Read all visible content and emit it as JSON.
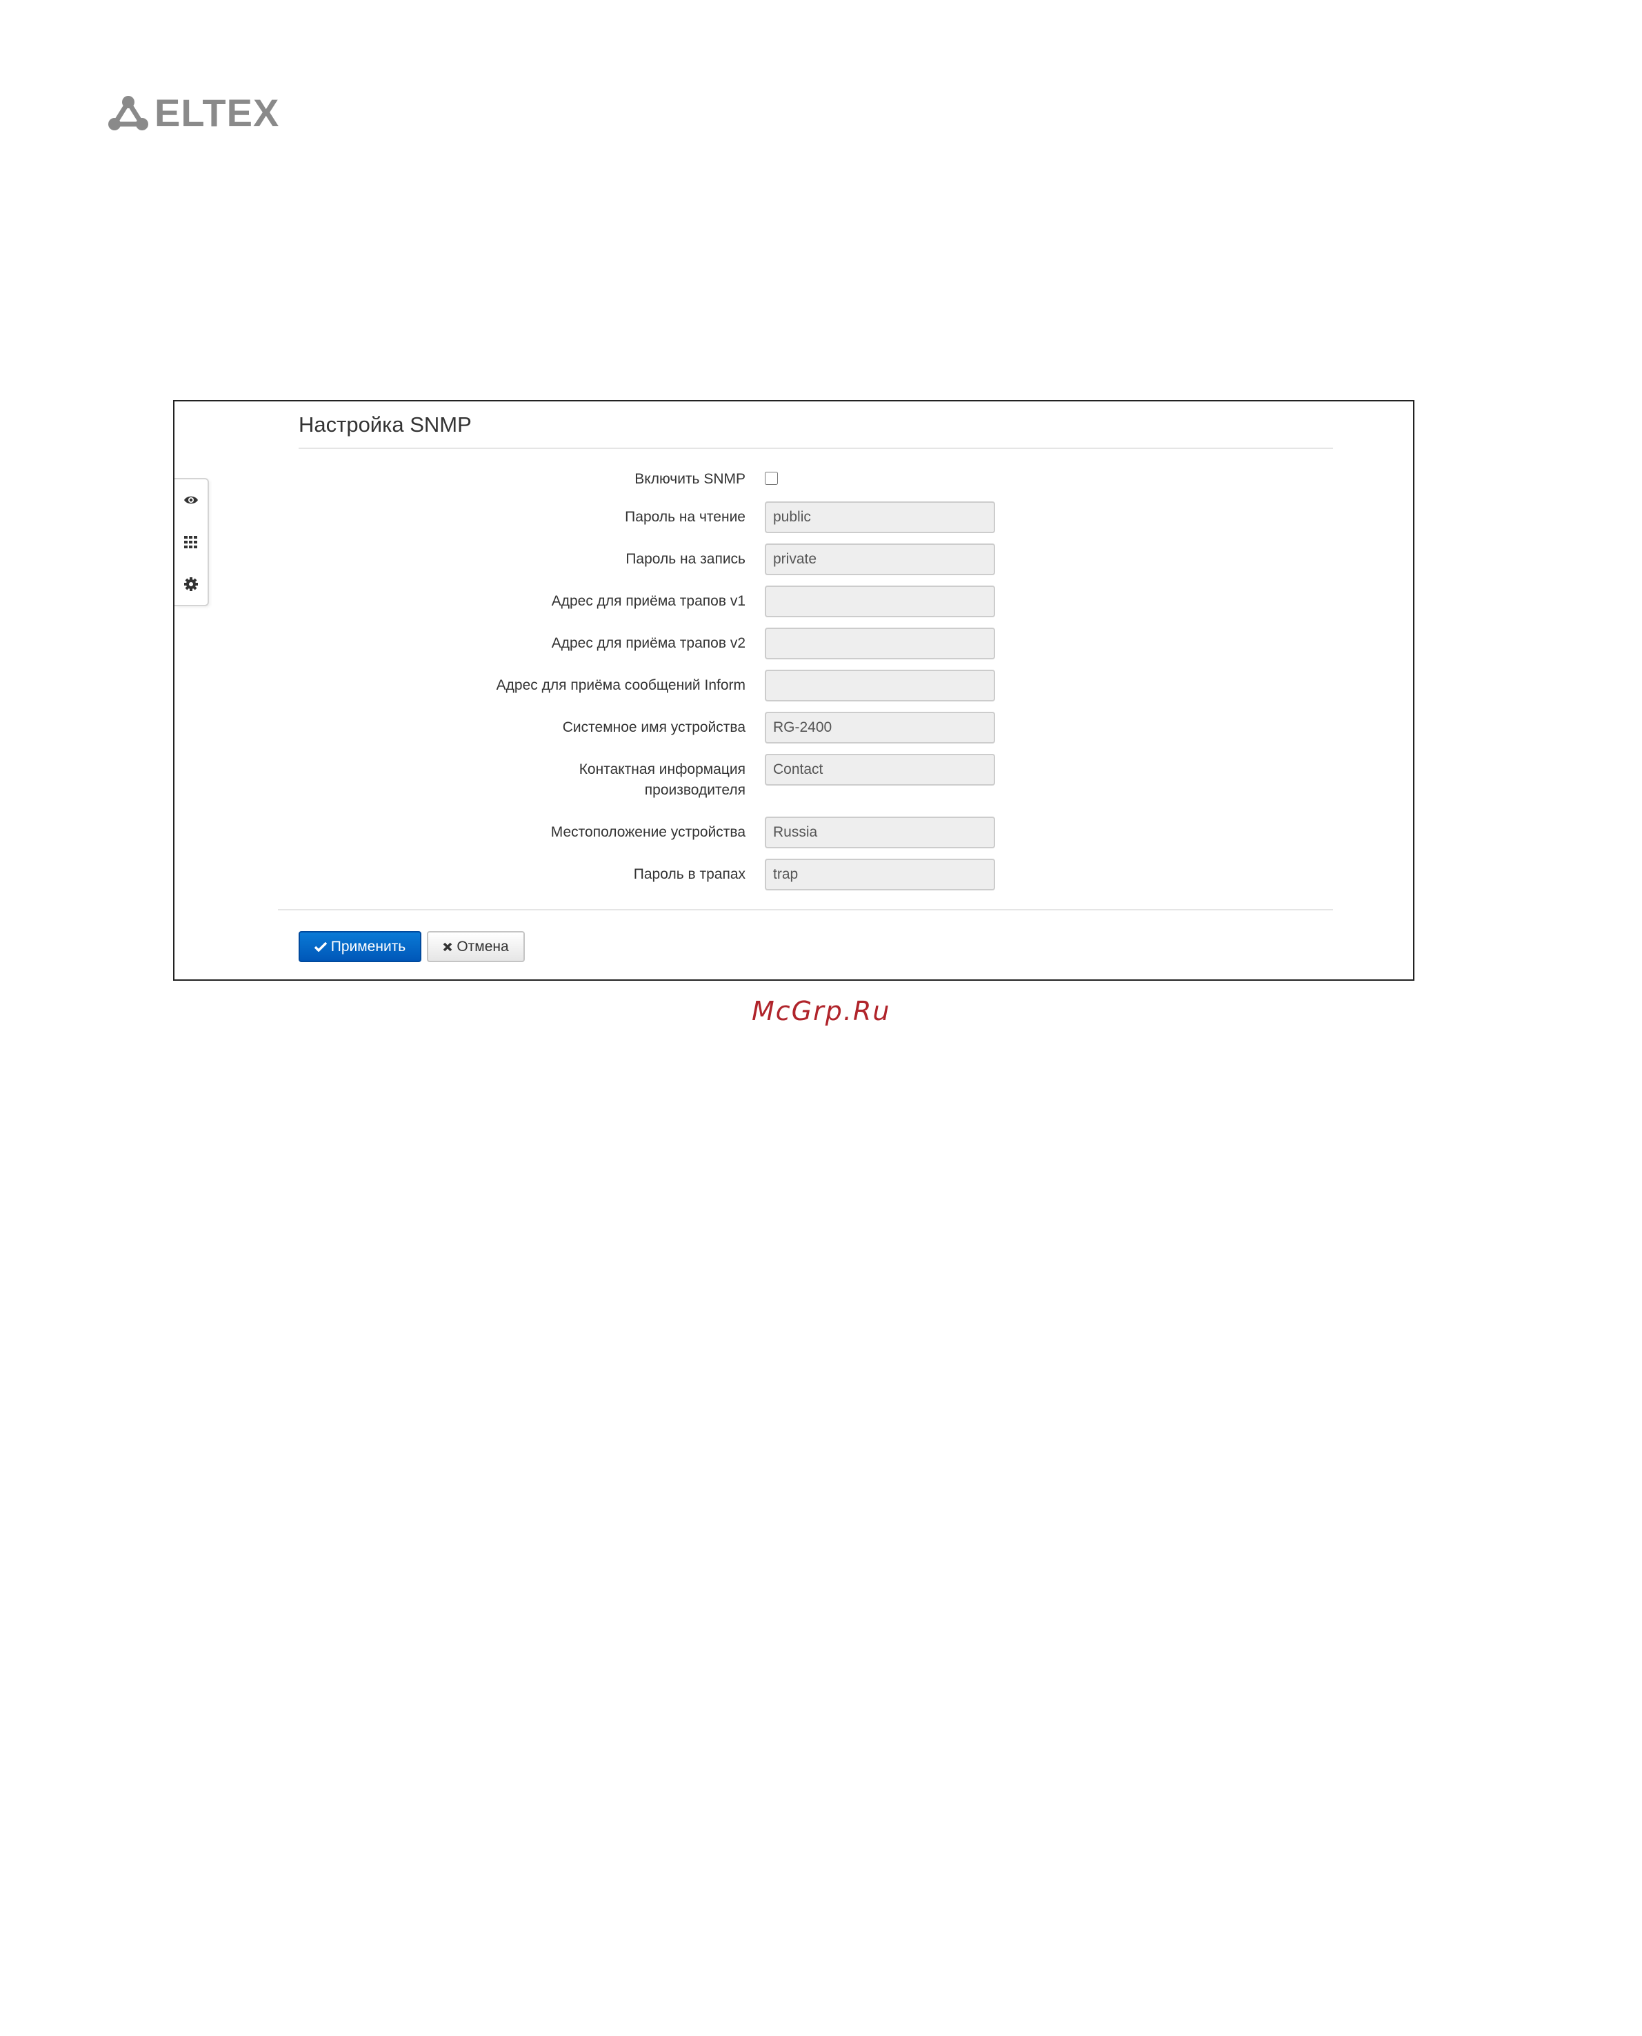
{
  "brand": {
    "logo_icon": "eltex-logo-icon",
    "logo_text": "ELTEX"
  },
  "toolbar": {
    "items": [
      {
        "icon": "eye-icon"
      },
      {
        "icon": "grid-icon"
      },
      {
        "icon": "gear-icon"
      }
    ]
  },
  "panel": {
    "title": "Настройка SNMP"
  },
  "form": {
    "enable_snmp": {
      "label": "Включить SNMP",
      "checked": false
    },
    "read_password": {
      "label": "Пароль на чтение",
      "value": "public"
    },
    "write_password": {
      "label": "Пароль на запись",
      "value": "private"
    },
    "trap_v1_address": {
      "label": "Адрес для приёма трапов v1",
      "value": ""
    },
    "trap_v2_address": {
      "label": "Адрес для приёма трапов v2",
      "value": ""
    },
    "inform_address": {
      "label": "Адрес для приёма сообщений Inform",
      "value": ""
    },
    "system_name": {
      "label": "Системное имя устройства",
      "value": "RG-2400"
    },
    "contact": {
      "label_line1": "Контактная информация",
      "label_line2": "производителя",
      "value": "Contact"
    },
    "location": {
      "label": "Местоположение устройства",
      "value": "Russia"
    },
    "trap_password": {
      "label": "Пароль в трапах",
      "value": "trap"
    }
  },
  "buttons": {
    "apply_label": "Применить",
    "cancel_label": "Отмена"
  },
  "watermark": {
    "text": "McGrp.Ru"
  },
  "colors": {
    "primary_button": "#0a6fcf",
    "watermark": "#b0242b",
    "logo_gray": "#8a8a8a"
  }
}
